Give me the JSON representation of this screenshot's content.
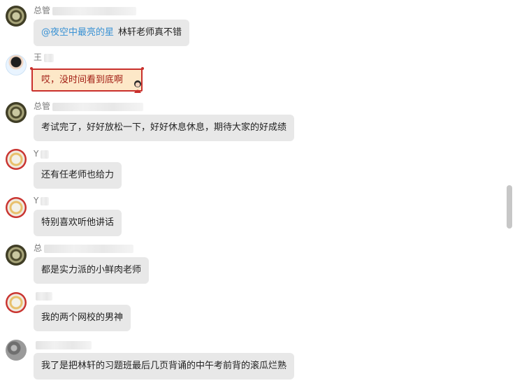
{
  "messages": [
    {
      "sender": "总管",
      "avatar": "admin-avatar",
      "text_mention": "@夜空中最亮的星",
      "text": "林轩老师真不错"
    },
    {
      "sender": "王",
      "avatar": "teacher-avatar",
      "text": "哎，没时间看到底啊",
      "style": "decorated-red-frame"
    },
    {
      "sender": "总管",
      "avatar": "admin-avatar",
      "text": "考试完了，好好放松一下，好好休息休息，期待大家的好成绩"
    },
    {
      "sender": "Y",
      "avatar": "yang-avatar",
      "text": "还有任老师也给力"
    },
    {
      "sender": "Y",
      "avatar": "yang-avatar",
      "text": "特别喜欢听他讲话"
    },
    {
      "sender": "总",
      "avatar": "admin-avatar",
      "text": "都是实力派的小鲜肉老师"
    },
    {
      "sender": "",
      "avatar": "yang-avatar",
      "text": "我的两个网校的男神"
    },
    {
      "sender": "",
      "avatar": "gray-avatar",
      "text": "我了是把林轩的习题班最后几页背诵的中午考前背的滚瓜烂熟"
    }
  ],
  "colors": {
    "bubble_bg": "#e8e8e8",
    "mention": "#3a92d4",
    "frame_border": "#c9302c",
    "frame_bg": "#fde8c8",
    "frame_text": "#a11c12"
  }
}
